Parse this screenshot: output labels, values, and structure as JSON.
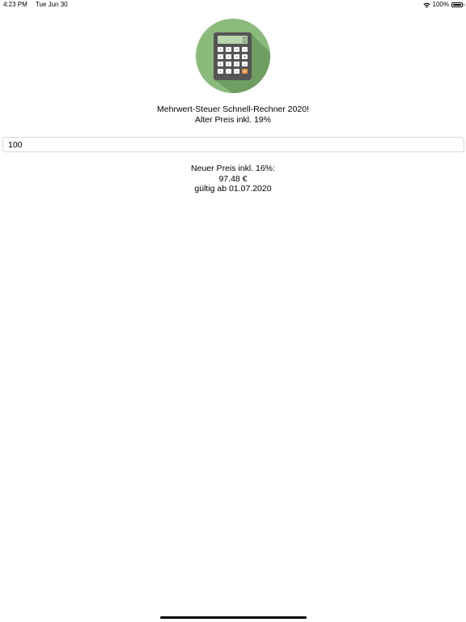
{
  "status_bar": {
    "time": "4:23 PM",
    "date": "Tue Jun 30",
    "battery_percent": "100%",
    "icons": [
      "wifi-icon",
      "battery-icon"
    ]
  },
  "app": {
    "logo_icon": "calculator-icon",
    "title": "Mehrwert-Steuer Schnell-Rechner 2020!",
    "subtitle": "Alter Preis inkl. 19%"
  },
  "input": {
    "value": "100"
  },
  "result": {
    "label": "Neuer Preis inkl. 16%:",
    "value": "97.48 €",
    "valid_from": "gültig ab 01.07.2020"
  },
  "colors": {
    "logo_circle": "#8cba7d",
    "calculator_body": "#555555",
    "accent_key": "#e8964a"
  }
}
